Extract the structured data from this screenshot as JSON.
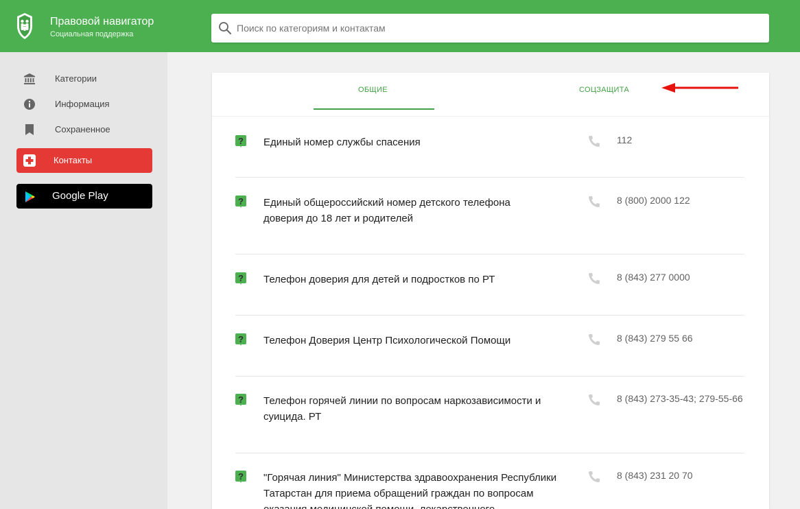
{
  "header": {
    "title": "Правовой навигатор",
    "subtitle": "Социальная поддержка",
    "brand_color": "#4caf50",
    "logo_icon": "family-shield-icon"
  },
  "search": {
    "placeholder": "Поиск по категориям и контактам",
    "value": "",
    "icon": "search-icon"
  },
  "sidebar": {
    "items": [
      {
        "label": "Категории",
        "icon": "bank-icon"
      },
      {
        "label": "Информация",
        "icon": "info-icon"
      },
      {
        "label": "Сохраненное",
        "icon": "bookmark-icon"
      }
    ],
    "contacts_label": "Контакты",
    "contacts_color": "#e53935",
    "google_play_label": "Google Play"
  },
  "tabs": [
    {
      "label": "ОБЩИЕ",
      "active": true
    },
    {
      "label": "СОЦЗАЩИТА",
      "active": false
    }
  ],
  "contacts": [
    {
      "title": "Единый номер службы спасения",
      "phone": "112"
    },
    {
      "title": "Единый общероссийский номер детского телефона доверия до 18 лет и родителей",
      "phone": "8 (800) 2000 122"
    },
    {
      "title": "Телефон доверия для детей и подростков по РТ",
      "phone": "8 (843) 277 0000"
    },
    {
      "title": "Телефон Доверия Центр Психологической Помощи",
      "phone": "8 (843) 279 55 66"
    },
    {
      "title": "Телефон горячей линии по вопросам наркозависимости и суицида. РТ",
      "phone": "8 (843) 273-35-43; 279-55-66"
    },
    {
      "title": "\"Горячая линия\" Министерства здравоохранения Республики Татарстан для приема обращений граждан по вопросам оказания медицинской помощи, лекарственного",
      "phone": "8 (843) 231 20 70"
    }
  ]
}
